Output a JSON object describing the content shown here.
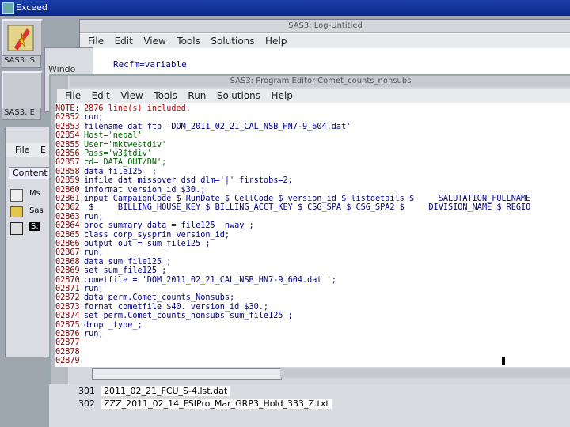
{
  "exceed": {
    "title": "Exceed"
  },
  "dock": {
    "labels": [
      "SAS3: S",
      "SAS3: E"
    ]
  },
  "log_window": {
    "title": "SAS3: Log-Untitled",
    "menu": [
      "File",
      "Edit",
      "View",
      "Tools",
      "Solutions",
      "Help"
    ],
    "line": "Recfm=variable"
  },
  "back_window": {
    "text": "Windo"
  },
  "mid_window": {
    "menu": [
      "File",
      "E"
    ],
    "tab": "Content",
    "items": [
      "Ms",
      "Sas",
      "S:"
    ]
  },
  "program_editor": {
    "title": "SAS3: Program Editor-Comet_counts_nonsubs",
    "menu": [
      "File",
      "Edit",
      "View",
      "Tools",
      "Run",
      "Solutions",
      "Help"
    ],
    "lines": [
      {
        "num": "NOTE:",
        "code": "2876 line(s) included.",
        "color": "red"
      },
      {
        "num": "02852",
        "code": "run;",
        "color": "blue"
      },
      {
        "num": "02853",
        "code": "filename dat ftp 'DOM_2011_02_21_CAL_NSB_HN7-9_604.dat'",
        "color": "blue"
      },
      {
        "num": "02854",
        "code": "Host='nepal'",
        "color": "green"
      },
      {
        "num": "02855",
        "code": "User='mktwestdiv'",
        "color": "green"
      },
      {
        "num": "02856",
        "code": "Pass='w3$tdiv'",
        "color": "green"
      },
      {
        "num": "02857",
        "code": "cd='DATA_OUT/DN';",
        "color": "green"
      },
      {
        "num": "02858",
        "code": "data file125  ;",
        "color": "blue"
      },
      {
        "num": "02859",
        "code": "infile dat missover dsd dlm='|' firstobs=2;",
        "color": "blue"
      },
      {
        "num": "02860",
        "code": "informat version_id $30.;",
        "color": "blue"
      },
      {
        "num": "02861",
        "code": "input CampaignCode $ RunDate $ CellCode $ version_id $ listdetails $     SALUTATION_FULLNAME",
        "color": "blue"
      },
      {
        "num": "02862",
        "code": " $     BILLING_HOUSE_KEY $ BILLING_ACCT_KEY $ CSG_SPA $ CSG_SPA2 $     DIVISION_NAME $ REGIO",
        "color": "blue"
      },
      {
        "num": "02863",
        "code": "run;",
        "color": "blue"
      },
      {
        "num": "02864",
        "code": "proc summary data = file125  nway ;",
        "color": "blue"
      },
      {
        "num": "02865",
        "code": "class corp_sysprin version_id;",
        "color": "blue"
      },
      {
        "num": "02866",
        "code": "output out = sum_file125 ;",
        "color": "blue"
      },
      {
        "num": "02867",
        "code": "run;",
        "color": "blue"
      },
      {
        "num": "02868",
        "code": "data sum_file125 ;",
        "color": "blue"
      },
      {
        "num": "02869",
        "code": "set sum_file125 ;",
        "color": "blue"
      },
      {
        "num": "02870",
        "code": "cometfile = 'DOM_2011_02_21_CAL_NSB_HN7-9_604.dat ';",
        "color": "blue"
      },
      {
        "num": "02871",
        "code": "run;",
        "color": "blue"
      },
      {
        "num": "02872",
        "code": "data perm.Comet_counts_Nonsubs;",
        "color": "blue"
      },
      {
        "num": "02873",
        "code": "format cometfile $40. version_id $30.;",
        "color": "blue"
      },
      {
        "num": "02874",
        "code": "set perm.Comet_counts_nonsubs sum_file125 ;",
        "color": "blue"
      },
      {
        "num": "02875",
        "code": "drop _type_;",
        "color": "blue"
      },
      {
        "num": "02876",
        "code": "run;",
        "color": "blue"
      },
      {
        "num": "02877",
        "code": "",
        "color": "blue"
      },
      {
        "num": "02878",
        "code": "",
        "color": "blue"
      },
      {
        "num": "02879",
        "code": "",
        "color": "blue"
      }
    ]
  },
  "bottom_list": {
    "rows": [
      {
        "num": "301",
        "value": "2011_02_21_FCU_S-4.lst.dat"
      },
      {
        "num": "302",
        "value": "ZZZ_2011_02_14_FSIPro_Mar_GRP3_Hold_333_Z.txt"
      }
    ]
  },
  "colors": {
    "titlebar": "#0a2a8a",
    "editor_bg": "#ffffff",
    "line_num": "#7a0000",
    "code": "#000080"
  }
}
